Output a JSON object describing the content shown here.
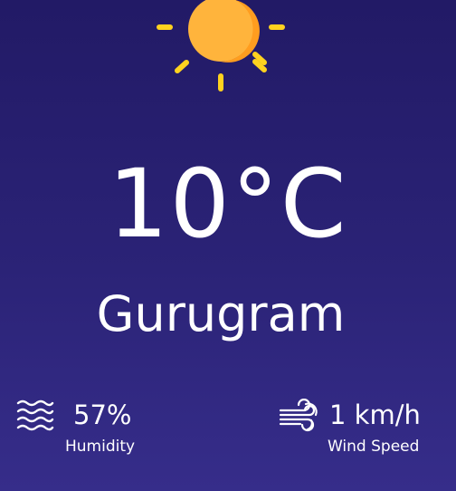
{
  "weather": {
    "temperature": "10°C",
    "city": "Gurugram",
    "condition_icon": "sun-icon"
  },
  "humidity": {
    "value": "57%",
    "label": "Humidity",
    "icon": "humidity-waves-icon"
  },
  "wind": {
    "value": "1 km/h",
    "label": "Wind Speed",
    "icon": "wind-icon"
  },
  "colors": {
    "background_top": "#221a66",
    "background_bottom": "#362d8a",
    "sun": "#ffb43c",
    "sun_shade": "#ff9d1f",
    "sun_rays": "#ffd21f",
    "text": "#ffffff"
  }
}
